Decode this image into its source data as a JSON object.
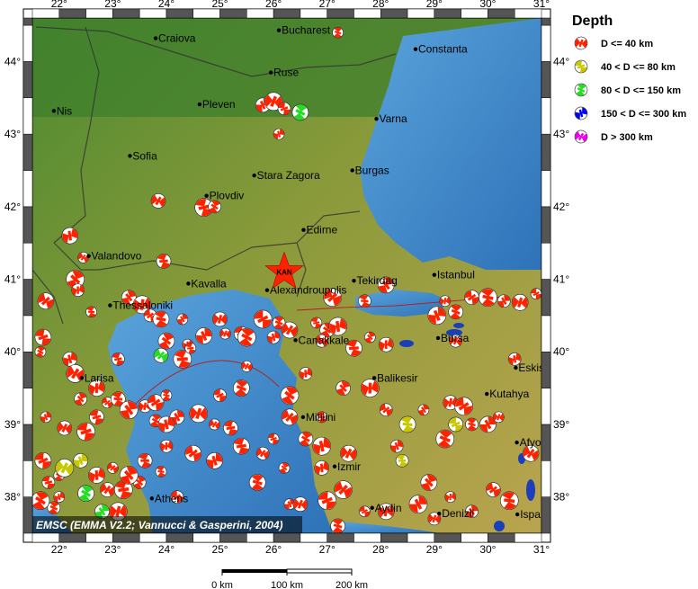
{
  "map": {
    "lon_min": 21.5,
    "lon_max": 31.0,
    "lat_min": 37.5,
    "lat_max": 44.6,
    "lon_ticks": [
      "22°",
      "23°",
      "24°",
      "25°",
      "26°",
      "27°",
      "28°",
      "29°",
      "30°",
      "31°"
    ],
    "lat_ticks": [
      "38°",
      "39°",
      "40°",
      "41°",
      "42°",
      "43°",
      "44°"
    ],
    "lon_tick_values": [
      22,
      23,
      24,
      25,
      26,
      27,
      28,
      29,
      30,
      31
    ],
    "lat_tick_values": [
      38,
      39,
      40,
      41,
      42,
      43,
      44
    ],
    "colors": {
      "sea": "#3e86c8",
      "lowland": "#3f7f2c",
      "upland": "#c9b25a",
      "frame": "#000000",
      "beachball": "#ff2200",
      "boundary": "#333333"
    }
  },
  "cities": [
    {
      "name": "Craiova",
      "lon": 23.8,
      "lat": 44.32
    },
    {
      "name": "Bucharest",
      "lon": 26.1,
      "lat": 44.43
    },
    {
      "name": "Constanta",
      "lon": 28.65,
      "lat": 44.17
    },
    {
      "name": "Ruse",
      "lon": 25.95,
      "lat": 43.85
    },
    {
      "name": "Pleven",
      "lon": 24.62,
      "lat": 43.41
    },
    {
      "name": "Nis",
      "lon": 21.9,
      "lat": 43.32
    },
    {
      "name": "Varna",
      "lon": 27.92,
      "lat": 43.21
    },
    {
      "name": "Sofia",
      "lon": 23.32,
      "lat": 42.7
    },
    {
      "name": "Stara Zagora",
      "lon": 25.64,
      "lat": 42.43
    },
    {
      "name": "Burgas",
      "lon": 27.47,
      "lat": 42.5
    },
    {
      "name": "Plovdiv",
      "lon": 24.75,
      "lat": 42.15
    },
    {
      "name": "Edirne",
      "lon": 26.56,
      "lat": 41.68
    },
    {
      "name": "Valandovo",
      "lon": 22.55,
      "lat": 41.32
    },
    {
      "name": "Kavalla",
      "lon": 24.41,
      "lat": 40.94
    },
    {
      "name": "Alexandroupolis",
      "lon": 25.88,
      "lat": 40.85
    },
    {
      "name": "Tekirdag",
      "lon": 27.5,
      "lat": 40.98
    },
    {
      "name": "Istanbul",
      "lon": 29.0,
      "lat": 41.06
    },
    {
      "name": "Thessaloniki",
      "lon": 22.95,
      "lat": 40.64
    },
    {
      "name": "Canakkale",
      "lon": 26.41,
      "lat": 40.16
    },
    {
      "name": "Bursa",
      "lon": 29.07,
      "lat": 40.19
    },
    {
      "name": "Eskisehir",
      "lon": 30.52,
      "lat": 39.78
    },
    {
      "name": "Larisa",
      "lon": 22.42,
      "lat": 39.64
    },
    {
      "name": "Balikesir",
      "lon": 27.88,
      "lat": 39.64
    },
    {
      "name": "Kutahya",
      "lon": 29.98,
      "lat": 39.42
    },
    {
      "name": "Mitilini",
      "lon": 26.55,
      "lat": 39.1
    },
    {
      "name": "Izmir",
      "lon": 27.14,
      "lat": 38.42
    },
    {
      "name": "Afyon",
      "lon": 30.54,
      "lat": 38.75
    },
    {
      "name": "Athens",
      "lon": 23.73,
      "lat": 37.98
    },
    {
      "name": "Aydin",
      "lon": 27.84,
      "lat": 37.85
    },
    {
      "name": "Denizli",
      "lon": 29.09,
      "lat": 37.77
    },
    {
      "name": "Isparta",
      "lon": 30.55,
      "lat": 37.76
    }
  ],
  "epicenter": {
    "label": "KAN",
    "lon": 26.2,
    "lat": 41.1,
    "color": "#ff2200"
  },
  "legend": {
    "title": "Depth",
    "items": [
      {
        "label": "D <= 40 km",
        "color": "#ff2200"
      },
      {
        "label": "40 < D <= 80 km",
        "color": "#c8c800"
      },
      {
        "label": "80 < D <= 150 km",
        "color": "#22dd22"
      },
      {
        "label": "150 < D <= 300 km",
        "color": "#0000ee"
      },
      {
        "label": "D > 300 km",
        "color": "#ee00ee"
      }
    ]
  },
  "credit": "EMSC (EMMA V2.2; Vannucci & Gasperini, 2004)",
  "scale_bar": {
    "labels": [
      "0 km",
      "100 km",
      "200 km"
    ]
  },
  "mechanisms": [
    [
      27.2,
      44.4,
      "red"
    ],
    [
      25.8,
      43.4,
      "red"
    ],
    [
      26.0,
      43.45,
      "red"
    ],
    [
      26.2,
      43.35,
      "red"
    ],
    [
      26.5,
      43.3,
      "green"
    ],
    [
      26.1,
      43.0,
      "red"
    ],
    [
      23.85,
      42.08,
      "red"
    ],
    [
      24.7,
      41.99,
      "red"
    ],
    [
      24.9,
      42.0,
      "red"
    ],
    [
      22.2,
      41.6,
      "red"
    ],
    [
      22.45,
      41.3,
      "red"
    ],
    [
      23.95,
      41.25,
      "red"
    ],
    [
      22.3,
      41.0,
      "red"
    ],
    [
      22.35,
      40.85,
      "red"
    ],
    [
      21.75,
      40.7,
      "red"
    ],
    [
      22.6,
      40.55,
      "red"
    ],
    [
      23.3,
      40.75,
      "red"
    ],
    [
      23.55,
      40.65,
      "red"
    ],
    [
      23.7,
      40.5,
      "red"
    ],
    [
      23.9,
      40.45,
      "red"
    ],
    [
      24.3,
      40.45,
      "red"
    ],
    [
      25.0,
      40.45,
      "red"
    ],
    [
      25.8,
      40.45,
      "red"
    ],
    [
      26.1,
      40.4,
      "red"
    ],
    [
      24.7,
      40.22,
      "red"
    ],
    [
      25.1,
      40.25,
      "red"
    ],
    [
      25.4,
      40.25,
      "red"
    ],
    [
      25.5,
      40.2,
      "red"
    ],
    [
      26.0,
      40.2,
      "red"
    ],
    [
      26.3,
      40.3,
      "red"
    ],
    [
      26.8,
      40.4,
      "red"
    ],
    [
      27.0,
      40.3,
      "red"
    ],
    [
      27.2,
      40.35,
      "red"
    ],
    [
      26.9,
      40.15,
      "red"
    ],
    [
      27.5,
      40.05,
      "red"
    ],
    [
      27.8,
      40.2,
      "red"
    ],
    [
      28.1,
      40.1,
      "red"
    ],
    [
      27.1,
      40.75,
      "red"
    ],
    [
      27.7,
      40.7,
      "red"
    ],
    [
      28.1,
      40.92,
      "red"
    ],
    [
      29.2,
      40.7,
      "red"
    ],
    [
      29.7,
      40.75,
      "red"
    ],
    [
      30.0,
      40.75,
      "red"
    ],
    [
      30.3,
      40.7,
      "red"
    ],
    [
      30.6,
      40.68,
      "red"
    ],
    [
      30.9,
      40.8,
      "red"
    ],
    [
      29.4,
      40.55,
      "red"
    ],
    [
      29.05,
      40.5,
      "red"
    ],
    [
      29.4,
      40.15,
      "red"
    ],
    [
      21.7,
      40.2,
      "red"
    ],
    [
      21.65,
      40.0,
      "red"
    ],
    [
      22.2,
      39.9,
      "red"
    ],
    [
      22.3,
      39.7,
      "red"
    ],
    [
      23.1,
      39.9,
      "red"
    ],
    [
      24.0,
      40.15,
      "red"
    ],
    [
      24.4,
      40.1,
      "red"
    ],
    [
      23.9,
      39.95,
      "green"
    ],
    [
      24.3,
      39.9,
      "red"
    ],
    [
      22.4,
      39.35,
      "red"
    ],
    [
      22.7,
      39.5,
      "red"
    ],
    [
      22.9,
      39.3,
      "red"
    ],
    [
      23.1,
      39.35,
      "red"
    ],
    [
      23.3,
      39.2,
      "red"
    ],
    [
      23.6,
      39.25,
      "red"
    ],
    [
      23.8,
      39.3,
      "red"
    ],
    [
      24.0,
      39.4,
      "red"
    ],
    [
      24.2,
      39.1,
      "red"
    ],
    [
      24.6,
      39.15,
      "red"
    ],
    [
      25.0,
      39.4,
      "red"
    ],
    [
      25.4,
      39.5,
      "red"
    ],
    [
      21.75,
      39.1,
      "red"
    ],
    [
      22.1,
      38.95,
      "red"
    ],
    [
      22.5,
      38.9,
      "red"
    ],
    [
      23.8,
      39.05,
      "red"
    ],
    [
      24.0,
      39.0,
      "red"
    ],
    [
      24.9,
      39.0,
      "red"
    ],
    [
      25.2,
      38.95,
      "red"
    ],
    [
      26.3,
      39.4,
      "red"
    ],
    [
      26.6,
      39.7,
      "red"
    ],
    [
      26.3,
      39.1,
      "red"
    ],
    [
      26.9,
      39.1,
      "red"
    ],
    [
      27.3,
      39.5,
      "red"
    ],
    [
      27.8,
      39.5,
      "red"
    ],
    [
      28.1,
      39.2,
      "red"
    ],
    [
      28.5,
      39.0,
      "yellow"
    ],
    [
      28.8,
      39.2,
      "red"
    ],
    [
      29.3,
      39.3,
      "red"
    ],
    [
      29.55,
      39.25,
      "red"
    ],
    [
      29.7,
      39.0,
      "red"
    ],
    [
      30.0,
      39.0,
      "red"
    ],
    [
      30.2,
      39.1,
      "red"
    ],
    [
      29.4,
      39.0,
      "yellow"
    ],
    [
      29.2,
      38.8,
      "red"
    ],
    [
      28.3,
      38.7,
      "red"
    ],
    [
      27.4,
      38.6,
      "red"
    ],
    [
      26.0,
      38.8,
      "red"
    ],
    [
      26.6,
      38.8,
      "red"
    ],
    [
      26.9,
      38.7,
      "red"
    ],
    [
      25.8,
      38.6,
      "red"
    ],
    [
      25.4,
      38.7,
      "red"
    ],
    [
      26.2,
      38.4,
      "red"
    ],
    [
      26.9,
      38.4,
      "red"
    ],
    [
      27.3,
      38.1,
      "red"
    ],
    [
      28.4,
      38.5,
      "yellow"
    ],
    [
      28.9,
      38.2,
      "red"
    ],
    [
      29.3,
      38.0,
      "red"
    ],
    [
      30.1,
      38.1,
      "red"
    ],
    [
      30.4,
      37.95,
      "red"
    ],
    [
      29.7,
      37.8,
      "red"
    ],
    [
      28.1,
      37.8,
      "red"
    ],
    [
      27.7,
      37.8,
      "red"
    ],
    [
      27.2,
      37.6,
      "red"
    ],
    [
      28.7,
      37.9,
      "red"
    ],
    [
      29.0,
      37.7,
      "red"
    ],
    [
      21.7,
      38.5,
      "red"
    ],
    [
      22.0,
      38.3,
      "red"
    ],
    [
      22.4,
      38.5,
      "yellow"
    ],
    [
      22.1,
      38.4,
      "yellow"
    ],
    [
      21.8,
      38.2,
      "red"
    ],
    [
      22.5,
      38.05,
      "green"
    ],
    [
      22.0,
      38.0,
      "red"
    ],
    [
      22.9,
      38.1,
      "red"
    ],
    [
      23.2,
      38.1,
      "red"
    ],
    [
      23.5,
      38.2,
      "red"
    ],
    [
      22.7,
      38.3,
      "red"
    ],
    [
      23.0,
      38.4,
      "red"
    ],
    [
      23.6,
      38.5,
      "red"
    ],
    [
      23.3,
      38.3,
      "red"
    ],
    [
      24.0,
      38.7,
      "red"
    ],
    [
      24.5,
      38.6,
      "red"
    ],
    [
      23.9,
      38.35,
      "red"
    ],
    [
      22.8,
      37.8,
      "green"
    ],
    [
      23.1,
      37.8,
      "red"
    ],
    [
      24.2,
      38.0,
      "red"
    ],
    [
      25.7,
      38.2,
      "red"
    ],
    [
      26.3,
      37.9,
      "red"
    ],
    [
      26.5,
      37.9,
      "red"
    ],
    [
      27.0,
      37.95,
      "red"
    ],
    [
      21.9,
      37.85,
      "red"
    ],
    [
      24.9,
      38.5,
      "red"
    ],
    [
      25.5,
      39.8,
      "red"
    ],
    [
      22.7,
      39.1,
      "red"
    ],
    [
      21.65,
      37.95,
      "red"
    ],
    [
      30.5,
      39.9,
      "red"
    ],
    [
      30.8,
      38.6,
      "red"
    ],
    [
      24.45,
      40.05,
      "red"
    ]
  ]
}
